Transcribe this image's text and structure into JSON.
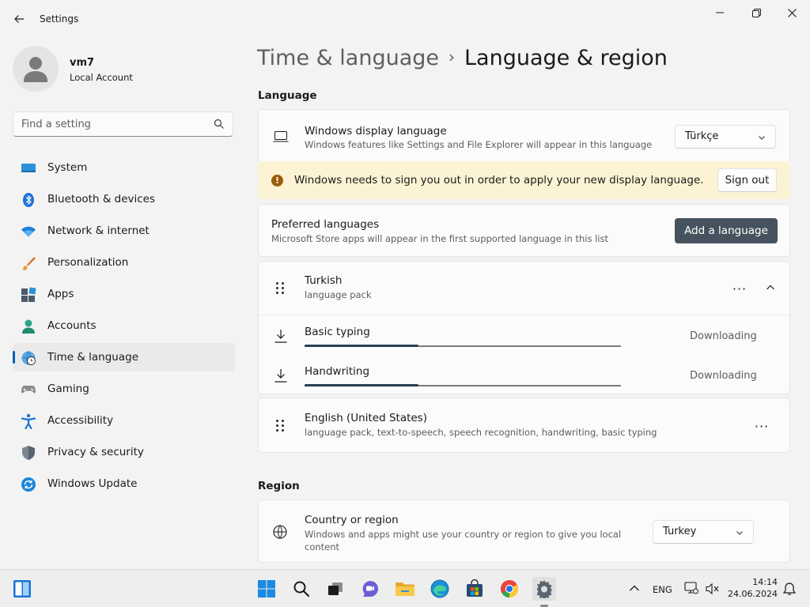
{
  "window": {
    "app_title": "Settings"
  },
  "account": {
    "name": "vm7",
    "type": "Local Account"
  },
  "search": {
    "placeholder": "Find a setting"
  },
  "sidebar": {
    "items": [
      {
        "label": "System",
        "icon": "system-icon"
      },
      {
        "label": "Bluetooth & devices",
        "icon": "bluetooth-icon"
      },
      {
        "label": "Network & internet",
        "icon": "wifi-icon"
      },
      {
        "label": "Personalization",
        "icon": "brush-icon"
      },
      {
        "label": "Apps",
        "icon": "apps-icon"
      },
      {
        "label": "Accounts",
        "icon": "accounts-icon"
      },
      {
        "label": "Time & language",
        "icon": "globe-clock-icon",
        "active": true
      },
      {
        "label": "Gaming",
        "icon": "gamepad-icon"
      },
      {
        "label": "Accessibility",
        "icon": "accessibility-icon"
      },
      {
        "label": "Privacy & security",
        "icon": "shield-icon"
      },
      {
        "label": "Windows Update",
        "icon": "update-icon"
      }
    ]
  },
  "header": {
    "parent": "Time & language",
    "separator": "›",
    "current": "Language & region"
  },
  "language": {
    "section_title": "Language",
    "display_language": {
      "title": "Windows display language",
      "subtitle": "Windows features like Settings and File Explorer will appear in this language",
      "selected": "Türkçe"
    },
    "warning": {
      "text": "Windows needs to sign you out in order to apply your new display language.",
      "icon_glyph": "!",
      "button": "Sign out"
    },
    "preferred": {
      "title": "Preferred languages",
      "subtitle": "Microsoft Store apps will appear in the first supported language in this list",
      "add_button": "Add a language"
    },
    "languages": [
      {
        "name": "Turkish",
        "detail": "language pack",
        "more": "···",
        "expanded": true,
        "features": [
          {
            "name": "Basic typing",
            "status": "Downloading",
            "progress": 0.36
          },
          {
            "name": "Handwriting",
            "status": "Downloading",
            "progress": 0.36
          }
        ]
      },
      {
        "name": "English (United States)",
        "detail": "language pack, text-to-speech, speech recognition, handwriting, basic typing",
        "more": "···"
      }
    ]
  },
  "region": {
    "section_title": "Region",
    "country": {
      "title": "Country or region",
      "subtitle_line1": "Windows and apps might use your country or region to give you local",
      "subtitle_line2": "content",
      "selected": "Turkey"
    }
  },
  "taskbar": {
    "apps": [
      "start-icon",
      "search-icon",
      "task-view-icon",
      "chat-icon",
      "file-explorer-icon",
      "edge-icon",
      "store-icon",
      "chrome-icon",
      "settings-icon"
    ],
    "tray": {
      "language": "ENG",
      "time": "14:14",
      "date": "24.06.2024"
    }
  }
}
